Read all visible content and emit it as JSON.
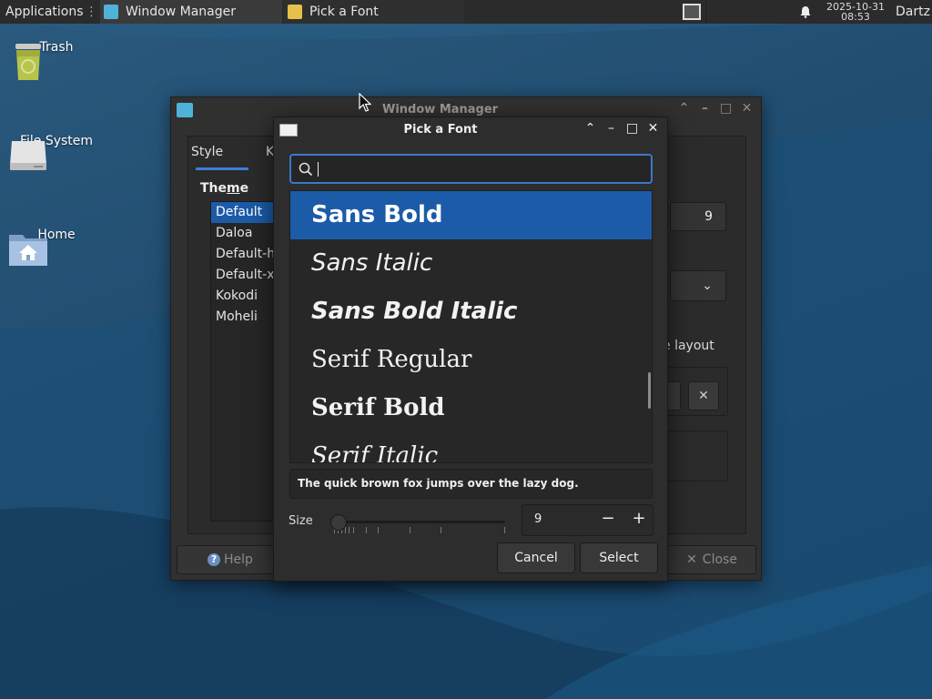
{
  "panel": {
    "applications_label": "Applications",
    "tasks": [
      {
        "label": "Window Manager"
      },
      {
        "label": "Pick a Font"
      }
    ],
    "clock_date": "2025-10-31",
    "clock_time": "08:53",
    "user": "Dartz"
  },
  "desktop": {
    "icons": [
      {
        "label": "Trash"
      },
      {
        "label": "File System"
      },
      {
        "label": "Home"
      }
    ]
  },
  "wm_window": {
    "title": "Window Manager",
    "tabs": [
      "Style",
      "K"
    ],
    "theme_label_pre": "The",
    "theme_label_u": "m",
    "theme_label_post": "e",
    "themes": [
      "Default",
      "Daloa",
      "Default-hc",
      "Default-xl",
      "Kokodi",
      "Moheli"
    ],
    "selected_theme": "Default",
    "font_size_value": "9",
    "layout_label_partial": "e layout",
    "help_label": "Help",
    "close_label": "Close"
  },
  "font_dialog": {
    "title": "Pick a Font",
    "search_value": "",
    "fonts": [
      {
        "name": "Sans Bold",
        "selected": true
      },
      {
        "name": "Sans Italic",
        "selected": false
      },
      {
        "name": "Sans Bold Italic",
        "selected": false
      },
      {
        "name": "Serif Regular",
        "selected": false
      },
      {
        "name": "Serif Bold",
        "selected": false
      },
      {
        "name": "Serif Italic",
        "selected": false
      }
    ],
    "preview_text": "The quick brown fox jumps over the lazy dog.",
    "size_label": "Size",
    "size_value": "9",
    "cancel_label": "Cancel",
    "select_label": "Select"
  },
  "colors": {
    "selection": "#1c5ba8",
    "focus_border": "#3b79c7",
    "panel_bg": "#2b2b2b",
    "window_bg": "#2d2d2d"
  }
}
